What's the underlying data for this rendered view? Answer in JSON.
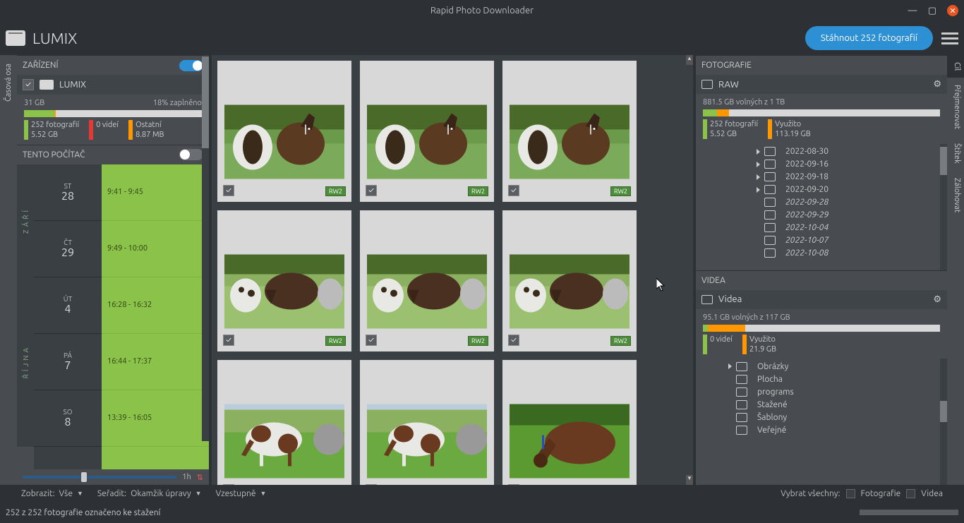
{
  "app": {
    "title": "Rapid Photo Downloader"
  },
  "topbar": {
    "device": "LUMIX",
    "download_btn": "Stáhnout 252 fotografií"
  },
  "rails": {
    "left": "Časová osa",
    "right": [
      "Cíl",
      "Přejmenovat",
      "Štítek",
      "Zálohovat"
    ]
  },
  "left": {
    "devices_header": "ZAŘÍZENÍ",
    "device": "LUMIX",
    "size": "31 GB",
    "fill": "18% zaplněno",
    "fill_pct": 18,
    "legend": {
      "photos": {
        "line1": "252 fotografií",
        "line2": "5.52 GB",
        "color": "#8bc34a"
      },
      "videos": {
        "line1": "0 videí",
        "line2": "",
        "color": "#e53935"
      },
      "other": {
        "line1": "Ostatní",
        "line2": "8.87 MB",
        "color": "#ff9800"
      }
    },
    "this_computer_header": "TENTO POČÍTAČ",
    "months": [
      "ZÁŘÍ",
      "ŘÍJNA"
    ],
    "days": [
      {
        "dow": "ST",
        "num": "28",
        "range": "9:41 - 9:45",
        "month": 0
      },
      {
        "dow": "ČT",
        "num": "29",
        "range": "9:49 - 10:00",
        "month": 0
      },
      {
        "dow": "ÚT",
        "num": "4",
        "range": "16:28 - 16:32",
        "month": 1
      },
      {
        "dow": "PÁ",
        "num": "7",
        "range": "16:44 - 17:37",
        "month": 1
      },
      {
        "dow": "SO",
        "num": "8",
        "range": "13:39 - 16:05",
        "month": 1
      }
    ],
    "zoom_label": "1h"
  },
  "thumbs": {
    "badge": "RW2",
    "items": [
      {
        "variant": 0
      },
      {
        "variant": 0
      },
      {
        "variant": 0
      },
      {
        "variant": 1
      },
      {
        "variant": 1
      },
      {
        "variant": 1
      },
      {
        "variant": 2
      },
      {
        "variant": 2
      },
      {
        "variant": 3
      }
    ]
  },
  "right": {
    "photos_header": "FOTOGRAFIE",
    "raw_label": "RAW",
    "photos_free": "881.5 GB volných z 1 TB",
    "photos_bar": {
      "green_pct": 6,
      "orange_pct": 11
    },
    "photos_legend": {
      "a": {
        "line1": "252 fotografií",
        "line2": "5.52 GB",
        "color": "#8bc34a"
      },
      "b": {
        "line1": "Využito",
        "line2": "113.19 GB",
        "color": "#ff9800"
      }
    },
    "photo_tree": [
      {
        "name": "2022-08-30",
        "expand": true
      },
      {
        "name": "2022-09-16",
        "expand": true
      },
      {
        "name": "2022-09-18",
        "expand": true
      },
      {
        "name": "2022-09-20",
        "expand": true
      },
      {
        "name": "2022-09-28",
        "italic": true
      },
      {
        "name": "2022-09-29",
        "italic": true
      },
      {
        "name": "2022-10-04",
        "italic": true
      },
      {
        "name": "2022-10-07",
        "italic": true
      },
      {
        "name": "2022-10-08",
        "italic": true
      }
    ],
    "videos_header": "VIDEA",
    "videos_dest": "Videa",
    "videos_free": "95.1 GB volných z 117 GB",
    "videos_bar": {
      "green_pct": 2,
      "orange_pct": 18
    },
    "videos_legend": {
      "a": {
        "line1": "0 videí",
        "line2": "",
        "color": "#8bc34a"
      },
      "b": {
        "line1": "Využito",
        "line2": "21.9 GB",
        "color": "#ff9800"
      }
    },
    "video_tree": [
      {
        "name": "Obrázky",
        "expand": true
      },
      {
        "name": "Plocha"
      },
      {
        "name": "programs"
      },
      {
        "name": "Stažené"
      },
      {
        "name": "Šablony"
      },
      {
        "name": "Veřejné"
      }
    ]
  },
  "filter": {
    "show_label": "Zobrazit:",
    "show_value": "Vše",
    "sort_label": "Seřadit:",
    "sort_value": "Okamžik úpravy",
    "dir_value": "Vzestupně",
    "select_all": "Vybrat všechny:",
    "photos_chk": "Fotografie",
    "videos_chk": "Videa"
  },
  "status": "252 z 252 fotografie označeno ke stažení"
}
